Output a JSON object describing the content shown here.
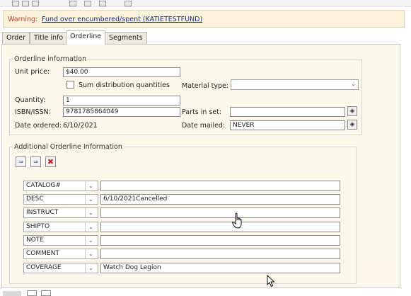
{
  "warning": {
    "label": "Warning:",
    "message": "Fund over encumbered/spent (KATIETESTFUND)"
  },
  "tabs": [
    {
      "label": "Order",
      "active": false
    },
    {
      "label": "Title info",
      "active": false
    },
    {
      "label": "Orderline",
      "active": true
    },
    {
      "label": "Segments",
      "active": false
    }
  ],
  "orderline_info": {
    "legend": "Orderline information",
    "unit_price_label": "Unit price:",
    "unit_price": "$40.00",
    "sum_dist_label": "Sum distribution quantities",
    "sum_dist_checked": false,
    "material_type_label": "Material type:",
    "material_type": "",
    "quantity_label": "Quantity:",
    "quantity": "1",
    "isbn_label": "ISBN/ISSN:",
    "isbn": "9781785864049",
    "parts_label": "Parts in set:",
    "parts": "",
    "date_ordered_label": "Date ordered:",
    "date_ordered": "6/10/2021",
    "date_mailed_label": "Date mailed:",
    "date_mailed": "NEVER"
  },
  "additional": {
    "legend": "Additional Orderline Information",
    "rows": [
      {
        "field": "CATALOG#",
        "value": ""
      },
      {
        "field": "DESC",
        "value": "6/10/2021Cancelled"
      },
      {
        "field": "INSTRUCT",
        "value": ""
      },
      {
        "field": "SHIPTO",
        "value": ""
      },
      {
        "field": "NOTE",
        "value": ""
      },
      {
        "field": "COMMENT",
        "value": ""
      },
      {
        "field": "COVERAGE",
        "value": "Watch Dog Legion"
      }
    ]
  },
  "icons": {
    "dropdown": "chevron-down-icon",
    "lookup": "diamond-lookup-icon",
    "insert_before": "insert-row-before-icon",
    "insert_after": "insert-row-after-icon",
    "delete": "delete-x-icon"
  },
  "colors": {
    "warning": "#c2412a",
    "link": "#1c2f8a",
    "delete": "#d21f1f",
    "panel": "#fdf8ec"
  }
}
